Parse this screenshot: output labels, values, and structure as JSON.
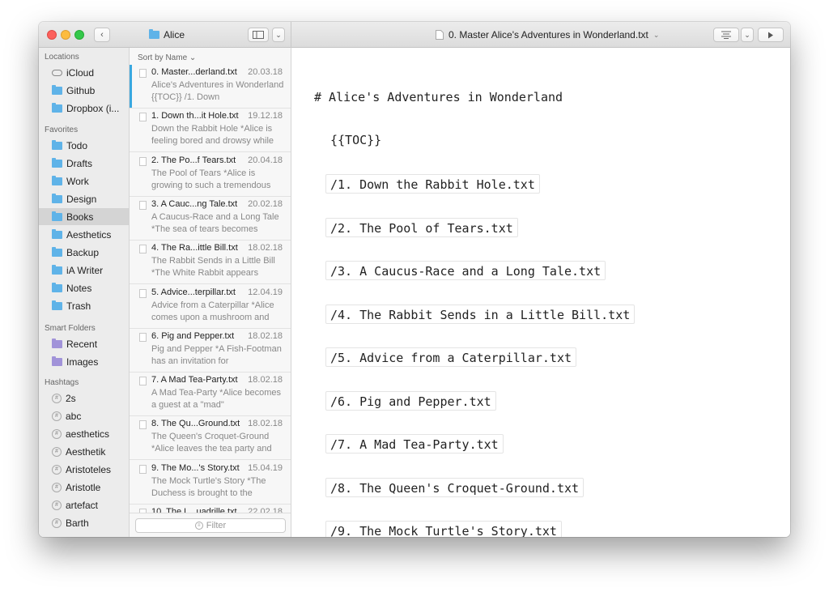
{
  "titlebar": {
    "folder_name": "Alice",
    "document_title": "0. Master Alice's Adventures in Wonderland.txt",
    "back_glyph": "‹",
    "chevron_glyph": "⌄"
  },
  "sidebar": {
    "sections": [
      {
        "heading": "Locations",
        "items": [
          {
            "label": "iCloud",
            "icon": "cloud-icon"
          },
          {
            "label": "Github",
            "icon": "folder-icon"
          },
          {
            "label": "Dropbox (i...",
            "icon": "dropbox-folder-icon"
          }
        ]
      },
      {
        "heading": "Favorites",
        "items": [
          {
            "label": "Todo",
            "icon": "folder-icon"
          },
          {
            "label": "Drafts",
            "icon": "folder-icon"
          },
          {
            "label": "Work",
            "icon": "folder-icon"
          },
          {
            "label": "Design",
            "icon": "folder-icon"
          },
          {
            "label": "Books",
            "icon": "folder-icon",
            "selected": true
          },
          {
            "label": "Aesthetics",
            "icon": "folder-icon"
          },
          {
            "label": "Backup",
            "icon": "folder-icon"
          },
          {
            "label": "iA Writer",
            "icon": "folder-icon"
          },
          {
            "label": "Notes",
            "icon": "folder-icon"
          },
          {
            "label": "Trash",
            "icon": "folder-icon"
          }
        ]
      },
      {
        "heading": "Smart Folders",
        "items": [
          {
            "label": "Recent",
            "icon": "smart-folder-icon"
          },
          {
            "label": "Images",
            "icon": "smart-folder-icon"
          }
        ]
      },
      {
        "heading": "Hashtags",
        "items": [
          {
            "label": "2s",
            "icon": "hashtag-icon"
          },
          {
            "label": "abc",
            "icon": "hashtag-icon"
          },
          {
            "label": "aesthetics",
            "icon": "hashtag-icon"
          },
          {
            "label": "Aesthetik",
            "icon": "hashtag-icon"
          },
          {
            "label": "Aristoteles",
            "icon": "hashtag-icon"
          },
          {
            "label": "Aristotle",
            "icon": "hashtag-icon"
          },
          {
            "label": "artefact",
            "icon": "hashtag-icon"
          },
          {
            "label": "Barth",
            "icon": "hashtag-icon"
          }
        ]
      }
    ]
  },
  "filelist": {
    "sort_label": "Sort by Name ⌄",
    "filter_placeholder": "Filter",
    "files": [
      {
        "name": "0. Master...derland.txt",
        "date": "20.03.18",
        "preview": "Alice's Adventures in Wonderland {{TOC}} /1. Down",
        "selected": true
      },
      {
        "name": "1. Down th...it Hole.txt",
        "date": "19.12.18",
        "preview": "Down the Rabbit Hole *Alice is feeling bored and drowsy while"
      },
      {
        "name": "2. The Po...f Tears.txt",
        "date": "20.04.18",
        "preview": "The Pool of Tears *Alice is growing to such a tremendous"
      },
      {
        "name": "3. A Cauc...ng Tale.txt",
        "date": "20.02.18",
        "preview": "A Caucus-Race and a Long Tale *The sea of tears becomes"
      },
      {
        "name": "4. The Ra...ittle Bill.txt",
        "date": "18.02.18",
        "preview": "The Rabbit Sends in a Little Bill *The White Rabbit appears"
      },
      {
        "name": "5. Advice...terpillar.txt",
        "date": "12.04.19",
        "preview": "Advice from a Caterpillar *Alice comes upon a mushroom and"
      },
      {
        "name": "6. Pig and Pepper.txt",
        "date": "18.02.18",
        "preview": "Pig and Pepper *A Fish-Footman has an invitation for"
      },
      {
        "name": "7. A Mad Tea-Party.txt",
        "date": "18.02.18",
        "preview": "A Mad Tea-Party *Alice becomes a guest at a \"mad\""
      },
      {
        "name": "8. The Qu...Ground.txt",
        "date": "18.02.18",
        "preview": "The Queen's Croquet-Ground *Alice leaves the tea party and"
      },
      {
        "name": "9. The Mo...'s Story.txt",
        "date": "15.04.19",
        "preview": "The Mock Turtle's Story *The Duchess is brought to the"
      },
      {
        "name": "10. The L...uadrille.txt",
        "date": "22.02.18",
        "preview": ""
      }
    ]
  },
  "editor": {
    "heading": "# Alice's Adventures in Wonderland",
    "toc": "{{TOC}}",
    "links": [
      "/1. Down the Rabbit Hole.txt",
      "/2. The Pool of Tears.txt",
      "/3. A Caucus-Race and a Long Tale.txt",
      "/4. The Rabbit Sends in a Little Bill.txt",
      "/5. Advice from a Caterpillar.txt",
      "/6. Pig and Pepper.txt",
      "/7. A Mad Tea-Party.txt",
      "/8. The Queen's Croquet-Ground.txt",
      "/9. The Mock Turtle's Story.txt"
    ]
  },
  "colors": {
    "accent": "#39a8e0",
    "folder": "#5fb3e8",
    "smart_folder": "#a193d9",
    "sidebar_bg": "#ececec",
    "selected_bg": "#d4d4d4"
  }
}
